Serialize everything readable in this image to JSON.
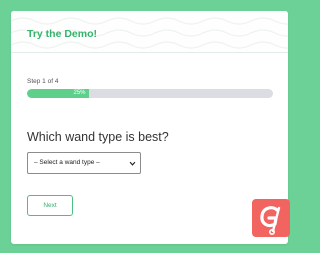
{
  "header": {
    "title": "Try the Demo!"
  },
  "step": {
    "label": "Step 1 of 4"
  },
  "progress": {
    "value": 0.25,
    "label": "25%"
  },
  "question": {
    "text": "Which wand type is best?"
  },
  "dropdown": {
    "selected": "– Select a wand type –"
  },
  "buttons": {
    "next": "Next"
  },
  "colors": {
    "background": "#6bd196",
    "accent": "#34b36a",
    "progress_fill": "#5fd08b",
    "progress_track": "#dcdde2",
    "logo": "#f2645f"
  },
  "icons": {
    "dropdown_caret": "chevron-down-icon",
    "logo": "gravity-forms-logo-icon"
  }
}
